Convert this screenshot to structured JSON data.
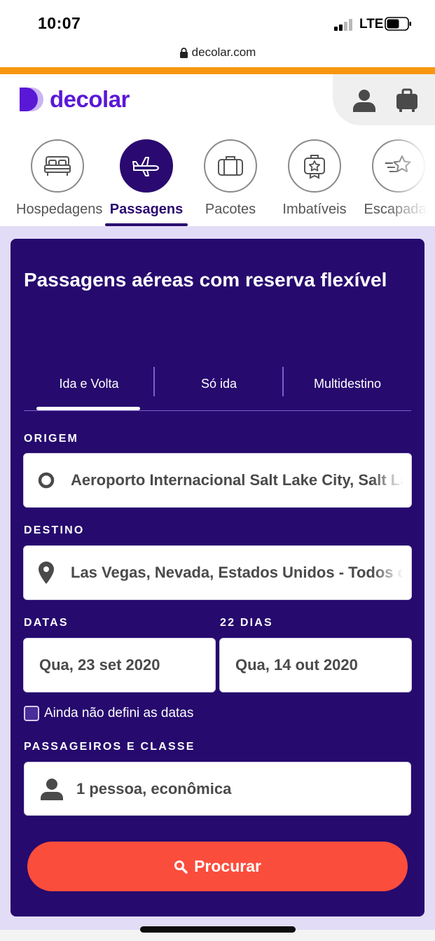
{
  "status_bar": {
    "time": "10:07",
    "network": "LTE"
  },
  "browser": {
    "url": "decolar.com"
  },
  "header": {
    "logo_text": "decolar",
    "brand_color": "#5a18d6",
    "accent_bar_color": "#f8970f"
  },
  "products": [
    {
      "label": "Hospedagens",
      "icon": "bed-icon",
      "active": false
    },
    {
      "label": "Passagens",
      "icon": "airplane-icon",
      "active": true
    },
    {
      "label": "Pacotes",
      "icon": "suitcase-icon",
      "active": false
    },
    {
      "label": "Imbatíveis",
      "icon": "star-bag-icon",
      "active": false
    },
    {
      "label": "Escapadas",
      "icon": "star-speed-icon",
      "active": false
    }
  ],
  "search_form": {
    "title": "Passagens aéreas com reserva flexível",
    "trip_types": [
      "Ida e Volta",
      "Só ida",
      "Multidestino"
    ],
    "selected_trip_type": "Ida e Volta",
    "origin": {
      "label": "ORIGEM",
      "value": "Aeroporto Internacional Salt Lake City, Salt Lake City"
    },
    "destination": {
      "label": "DESTINO",
      "value": "Las Vegas, Nevada, Estados Unidos - Todos os aeroportos"
    },
    "dates": {
      "label": "DATAS",
      "duration_label": "22 DIAS",
      "departure": "Qua, 23 set 2020",
      "return": "Qua, 14 out 2020"
    },
    "undefined_dates_checkbox": {
      "label": "Ainda não defini as datas",
      "checked": false
    },
    "passengers": {
      "label": "PASSAGEIROS E CLASSE",
      "value": "1 pessoa, econômica"
    },
    "search_button": "Procurar",
    "colors": {
      "card": "#260a6e",
      "button": "#fb4d3c"
    }
  }
}
